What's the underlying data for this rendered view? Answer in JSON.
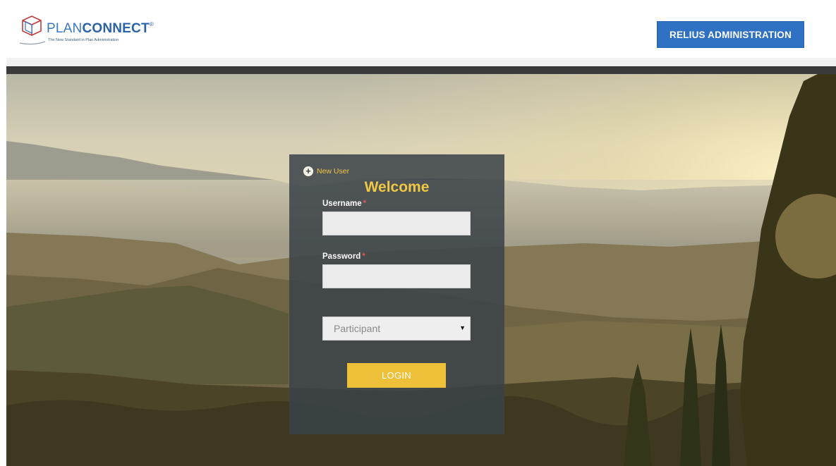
{
  "header": {
    "logo": {
      "brand_plan": "PLAN",
      "brand_connect": "CONNECT",
      "registered": "®",
      "tagline": "The New Standard in Plan Administration"
    },
    "relius_button_label": "RELIUS ADMINISTRATION"
  },
  "login": {
    "new_user_label": "New User",
    "new_user_icon": "plus-circle-icon",
    "title": "Welcome",
    "username": {
      "label": "Username",
      "required_marker": "*",
      "value": "",
      "placeholder": ""
    },
    "password": {
      "label": "Password",
      "required_marker": "*",
      "value": "",
      "placeholder": ""
    },
    "role_select": {
      "selected": "Participant",
      "arrow_icon": "dropdown-arrow-icon"
    },
    "login_button_label": "LOGIN"
  },
  "colors": {
    "brand_blue": "#2f72c4",
    "accent_yellow": "#f0c742",
    "login_button": "#eebf38",
    "panel": "#3a4248",
    "dark_bar": "#3a3a3a"
  }
}
